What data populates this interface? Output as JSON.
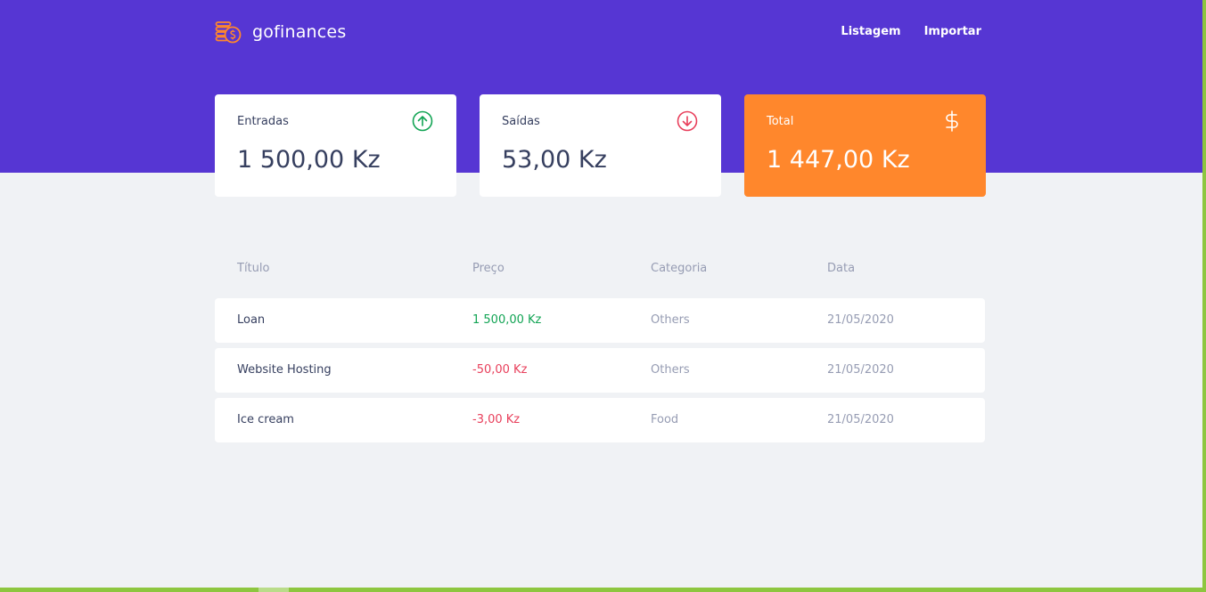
{
  "app": {
    "name": "gofinances",
    "logo_icon": "coins-icon"
  },
  "nav": {
    "items": [
      {
        "label": "Listagem"
      },
      {
        "label": "Importar"
      }
    ]
  },
  "summary": {
    "income": {
      "label": "Entradas",
      "value": "1 500,00 Kz",
      "icon": "arrow-up-circle-icon",
      "color": "#12a454"
    },
    "outcome": {
      "label": "Saídas",
      "value": "53,00 Kz",
      "icon": "arrow-down-circle-icon",
      "color": "#e83f5b"
    },
    "total": {
      "label": "Total",
      "value": "1 447,00 Kz",
      "icon": "dollar-sign-icon",
      "color": "#ff872c"
    }
  },
  "table": {
    "headers": [
      "Título",
      "Preço",
      "Categoria",
      "Data"
    ],
    "rows": [
      {
        "title": "Loan",
        "price": "1 500,00 Kz",
        "type": "income",
        "category": "Others",
        "date": "21/05/2020"
      },
      {
        "title": "Website Hosting",
        "price": "-50,00 Kz",
        "type": "outcome",
        "category": "Others",
        "date": "21/05/2020"
      },
      {
        "title": "Ice cream",
        "price": "-3,00 Kz",
        "type": "outcome",
        "category": "Food",
        "date": "21/05/2020"
      }
    ]
  },
  "colors": {
    "header_bg": "#5636d3",
    "page_bg": "#f0f2f5",
    "text": "#363f5f",
    "muted": "#969cb3",
    "income": "#12a454",
    "outcome": "#e83f5b",
    "total_bg": "#ff872c"
  }
}
